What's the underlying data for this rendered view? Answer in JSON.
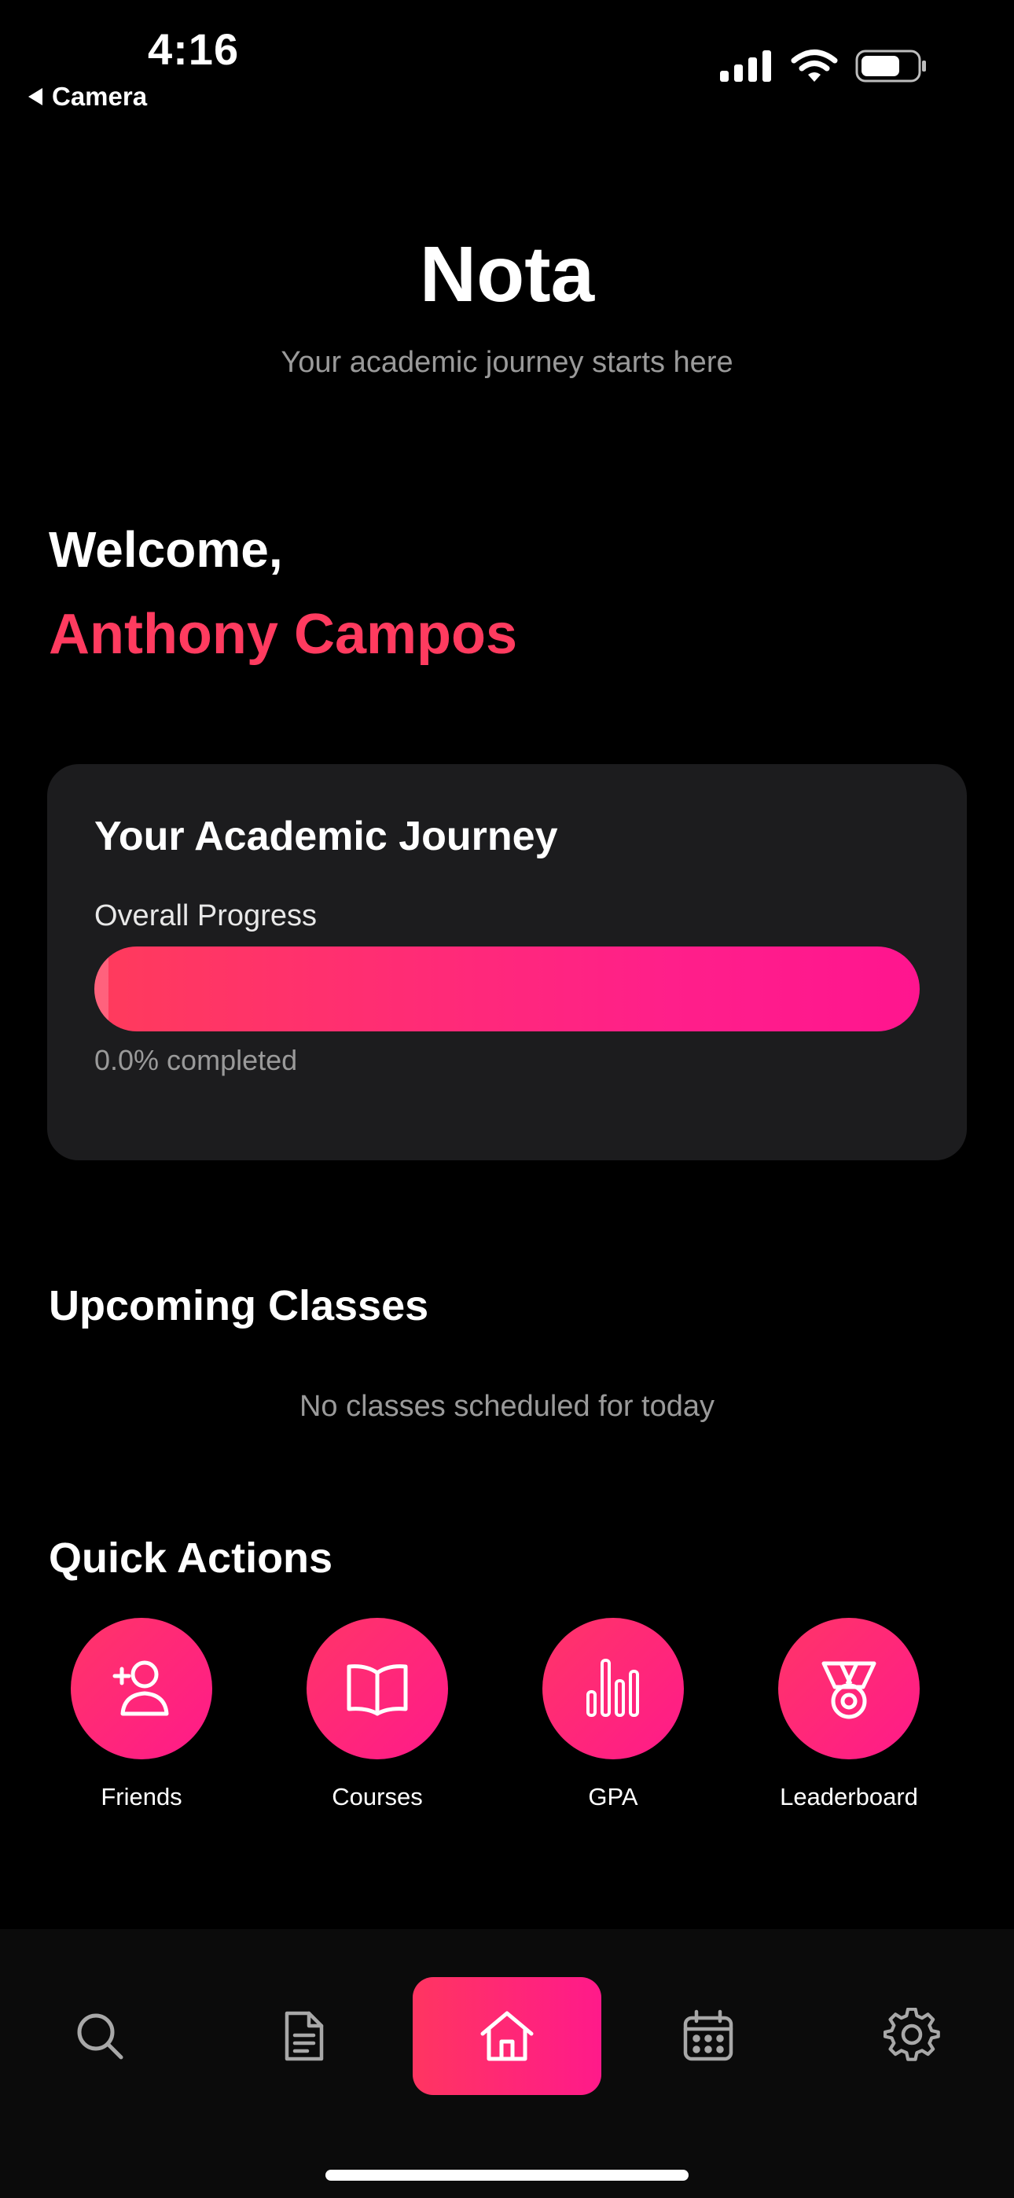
{
  "status_bar": {
    "time": "4:16",
    "back_label": "Camera",
    "icons": [
      "cellular-signal-icon",
      "wifi-icon",
      "battery-icon"
    ]
  },
  "header": {
    "title": "Nota",
    "subtitle": "Your academic journey starts here"
  },
  "welcome": {
    "greeting": "Welcome,",
    "name": "Anthony Campos"
  },
  "journey_card": {
    "title": "Your Academic Journey",
    "progress_label": "Overall Progress",
    "progress_percent": 0.0,
    "progress_text": "0.0% completed"
  },
  "upcoming": {
    "title": "Upcoming Classes",
    "empty_message": "No classes scheduled for today"
  },
  "quick_actions": {
    "title": "Quick Actions",
    "items": [
      {
        "label": "Friends",
        "icon": "add-friend-icon"
      },
      {
        "label": "Courses",
        "icon": "open-book-icon"
      },
      {
        "label": "GPA",
        "icon": "bar-chart-icon"
      },
      {
        "label": "Leaderboard",
        "icon": "medal-icon"
      }
    ]
  },
  "bottom_nav": {
    "items": [
      {
        "icon": "search-icon",
        "active": false
      },
      {
        "icon": "document-icon",
        "active": false
      },
      {
        "icon": "home-icon",
        "active": true
      },
      {
        "icon": "calendar-icon",
        "active": false
      },
      {
        "icon": "settings-gear-icon",
        "active": false
      }
    ]
  },
  "colors": {
    "background": "#000000",
    "card": "#1c1c1e",
    "accent_start": "#ff3b5c",
    "accent_end": "#ff158f",
    "muted_text": "#9a9a9a"
  }
}
